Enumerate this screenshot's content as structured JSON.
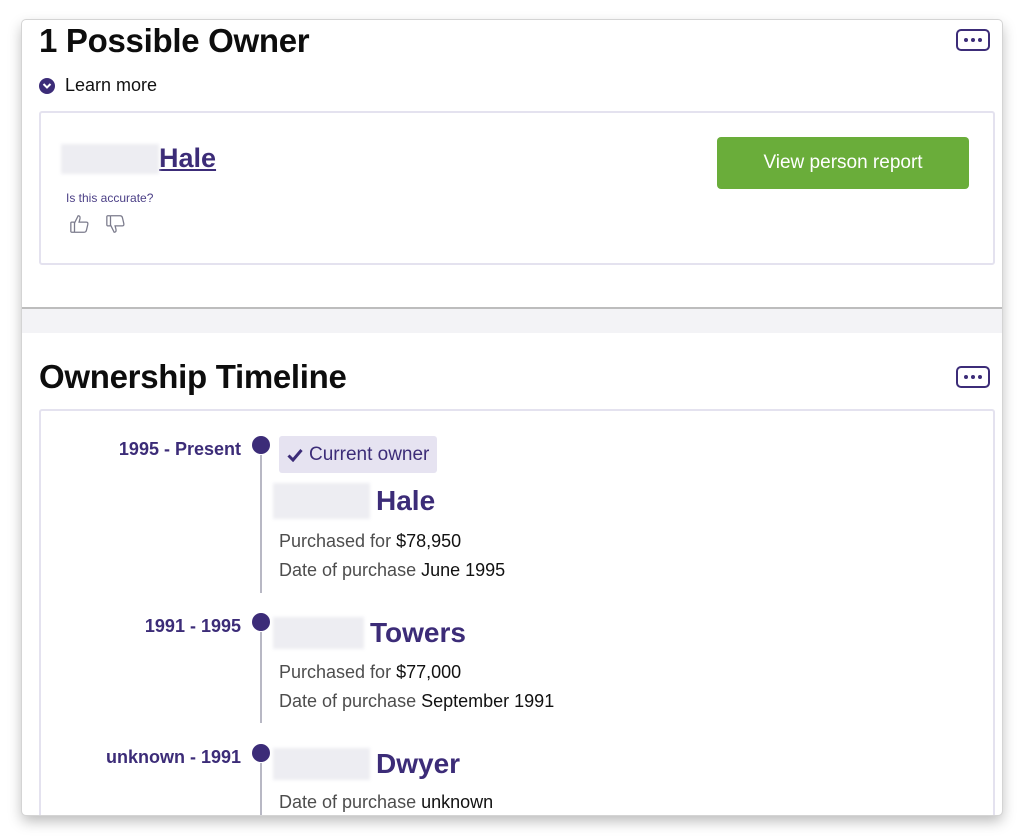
{
  "possible_owner": {
    "title": "1 Possible Owner",
    "learn_more": "Learn more",
    "owner_last_name": "Hale",
    "accuracy_question": "Is this accurate?",
    "view_report_label": "View person report",
    "accent_color": "#3c2c78",
    "button_color": "#6aad3a"
  },
  "timeline": {
    "title": "Ownership Timeline",
    "current_badge": "Current owner",
    "entries": [
      {
        "range": "1995 - Present",
        "last_name": "Hale",
        "purchased_label": "Purchased for",
        "purchased_value": "$78,950",
        "date_label": "Date of purchase",
        "date_value": "June 1995"
      },
      {
        "range": "1991 - 1995",
        "last_name": "Towers",
        "purchased_label": "Purchased for",
        "purchased_value": "$77,000",
        "date_label": "Date of purchase",
        "date_value": "September 1991"
      },
      {
        "range": "unknown - 1991",
        "last_name": "Dwyer",
        "date_label": "Date of purchase",
        "date_value": "unknown"
      }
    ]
  },
  "icons": [
    "more-options-icon",
    "chevron-down-icon",
    "thumbs-up-icon",
    "thumbs-down-icon",
    "checkmark-icon"
  ]
}
